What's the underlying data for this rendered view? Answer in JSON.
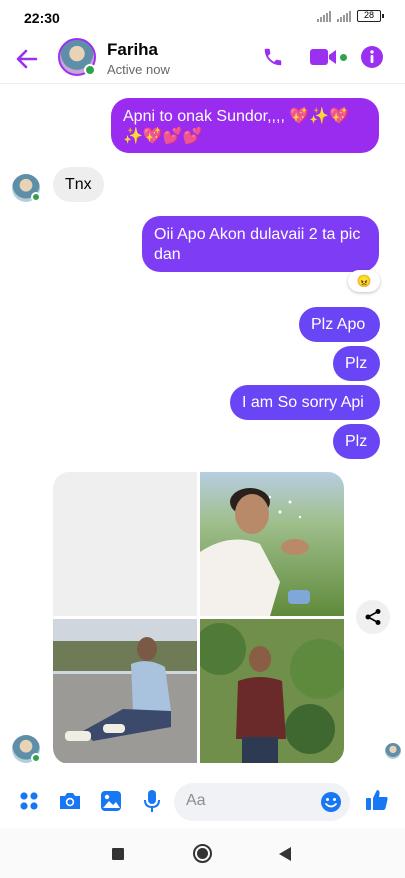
{
  "status_bar": {
    "time": "22:30",
    "battery": "28"
  },
  "header": {
    "contact_name": "Fariha",
    "contact_status": "Active now",
    "accent_color": "#9b30f0"
  },
  "messages": [
    {
      "side": "out",
      "text": "Apni to onak Sundor,,,, 💖✨💖✨💖💕💕"
    },
    {
      "side": "in",
      "text": "Tnx"
    },
    {
      "side": "out",
      "text": "Oii Apo Akon dulavaii 2 ta pic dan",
      "reaction": "😠"
    },
    {
      "side": "out",
      "text": "Plz Apo"
    },
    {
      "side": "out",
      "text": "Plz"
    },
    {
      "side": "out",
      "text": "I am So sorry Api"
    },
    {
      "side": "out",
      "text": "Plz"
    }
  ],
  "attachments": {
    "photo_count": 4,
    "photos": [
      "loading-placeholder",
      "man-splashing-water",
      "man-sitting-on-road",
      "man-standing-in-garden"
    ]
  },
  "composer": {
    "placeholder": "Aa",
    "icons": [
      "more-apps-icon",
      "camera-icon",
      "gallery-icon",
      "microphone-icon",
      "emoji-icon",
      "like-icon"
    ]
  },
  "colors": {
    "brand": "#9b30f0",
    "bubble_out": "#7f3cf5",
    "like_blue": "#1877f2"
  }
}
